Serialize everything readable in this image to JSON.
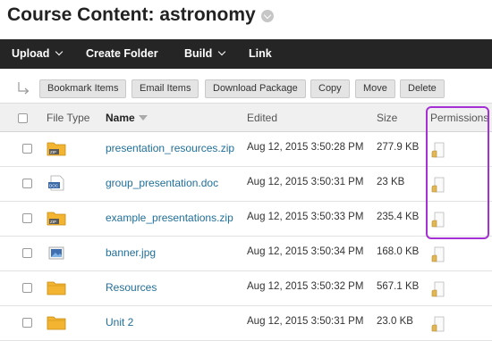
{
  "page": {
    "title": "Course Content: astronomy"
  },
  "menu": {
    "upload": "Upload",
    "create_folder": "Create Folder",
    "build": "Build",
    "link": "Link"
  },
  "actions": {
    "bookmark": "Bookmark Items",
    "email": "Email Items",
    "download": "Download Package",
    "copy": "Copy",
    "move": "Move",
    "delete": "Delete"
  },
  "table": {
    "headers": {
      "file_type": "File Type",
      "name": "Name",
      "edited": "Edited",
      "size": "Size",
      "permissions": "Permissions"
    },
    "rows": [
      {
        "type": "zip",
        "name": "presentation_resources.zip",
        "edited": "Aug 12, 2015 3:50:28 PM",
        "size": "277.9 KB"
      },
      {
        "type": "doc",
        "name": "group_presentation.doc",
        "edited": "Aug 12, 2015 3:50:31 PM",
        "size": "23 KB"
      },
      {
        "type": "zip",
        "name": "example_presentations.zip",
        "edited": "Aug 12, 2015 3:50:33 PM",
        "size": "235.4 KB"
      },
      {
        "type": "image",
        "name": "banner.jpg",
        "edited": "Aug 12, 2015 3:50:34 PM",
        "size": "168.0 KB"
      },
      {
        "type": "folder",
        "name": "Resources",
        "edited": "Aug 12, 2015 3:50:32 PM",
        "size": "567.1 KB"
      },
      {
        "type": "folder",
        "name": "Unit 2",
        "edited": "Aug 12, 2015 3:50:31 PM",
        "size": "23.0 KB"
      }
    ]
  },
  "colors": {
    "menubar": "#252525",
    "link": "#1f6f9a",
    "highlight": "#a530d6",
    "folder": "#f2b431"
  }
}
